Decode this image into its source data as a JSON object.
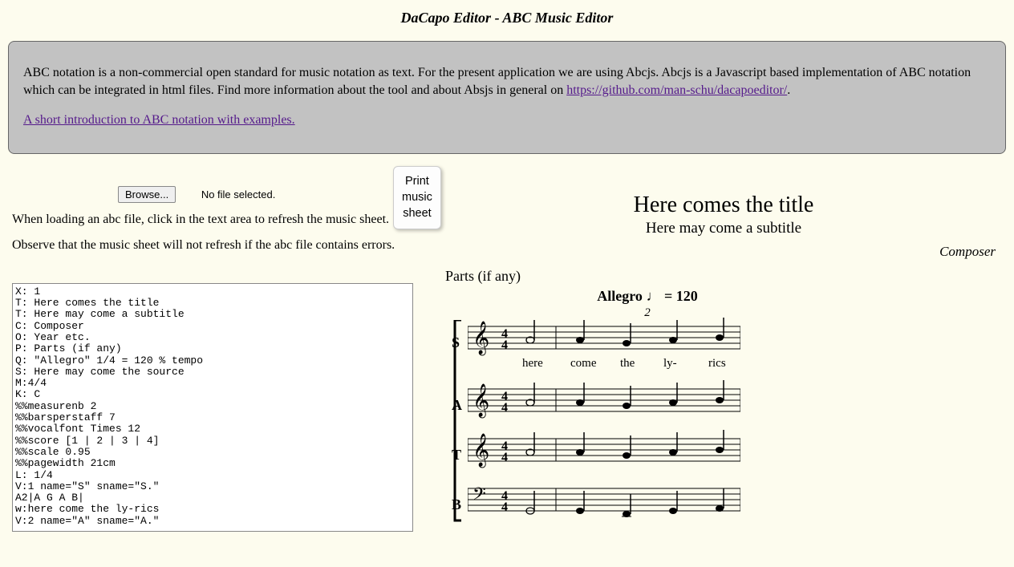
{
  "title": "DaCapo Editor - ABC Music Editor",
  "info": {
    "para1_prefix": "ABC notation is a non-commercial open standard for music notation as text. For the present application we are using Abcjs. Abcjs is a Javascript based implementation of ABC notation which can be integrated in html files. Find more information about the tool and about Absjs in general on ",
    "link1": "https://github.com/man-schu/dacapoeditor/",
    "para1_suffix": ".",
    "link2": "A short introduction to ABC notation with examples."
  },
  "file": {
    "browse": "Browse...",
    "nofile": "No file selected."
  },
  "hints": {
    "line1": "When loading an abc file, click in the text area to refresh the music sheet.",
    "line2": "Observe that the music sheet will not refresh if the abc file contains errors."
  },
  "print_btn": "Print\nmusic\nsheet",
  "abc_text": "X: 1\nT: Here comes the title\nT: Here may come a subtitle\nC: Composer\nO: Year etc.\nP: Parts (if any)\nQ: \"Allegro\" 1/4 = 120 % tempo\nS: Here may come the source\nM:4/4\nK: C\n%%measurenb 2\n%%barsperstaff 7\n%%vocalfont Times 12\n%%score [1 | 2 | 3 | 4]\n%%scale 0.95\n%%pagewidth 21cm\nL: 1/4\nV:1 name=\"S\" sname=\"S.\"\nA2|A G A B|\nw:here come the ly-rics\nV:2 name=\"A\" sname=\"A.\"",
  "sheet": {
    "title": "Here comes the title",
    "subtitle": "Here may come a subtitle",
    "composer": "Composer",
    "parts": "Parts (if any)",
    "tempo_text": "Allegro",
    "tempo_val": " = 120",
    "barnum": "2",
    "voices": [
      "S",
      "A",
      "T",
      "B"
    ],
    "lyrics": [
      "here",
      "come",
      "the",
      "ly-",
      "rics"
    ]
  }
}
